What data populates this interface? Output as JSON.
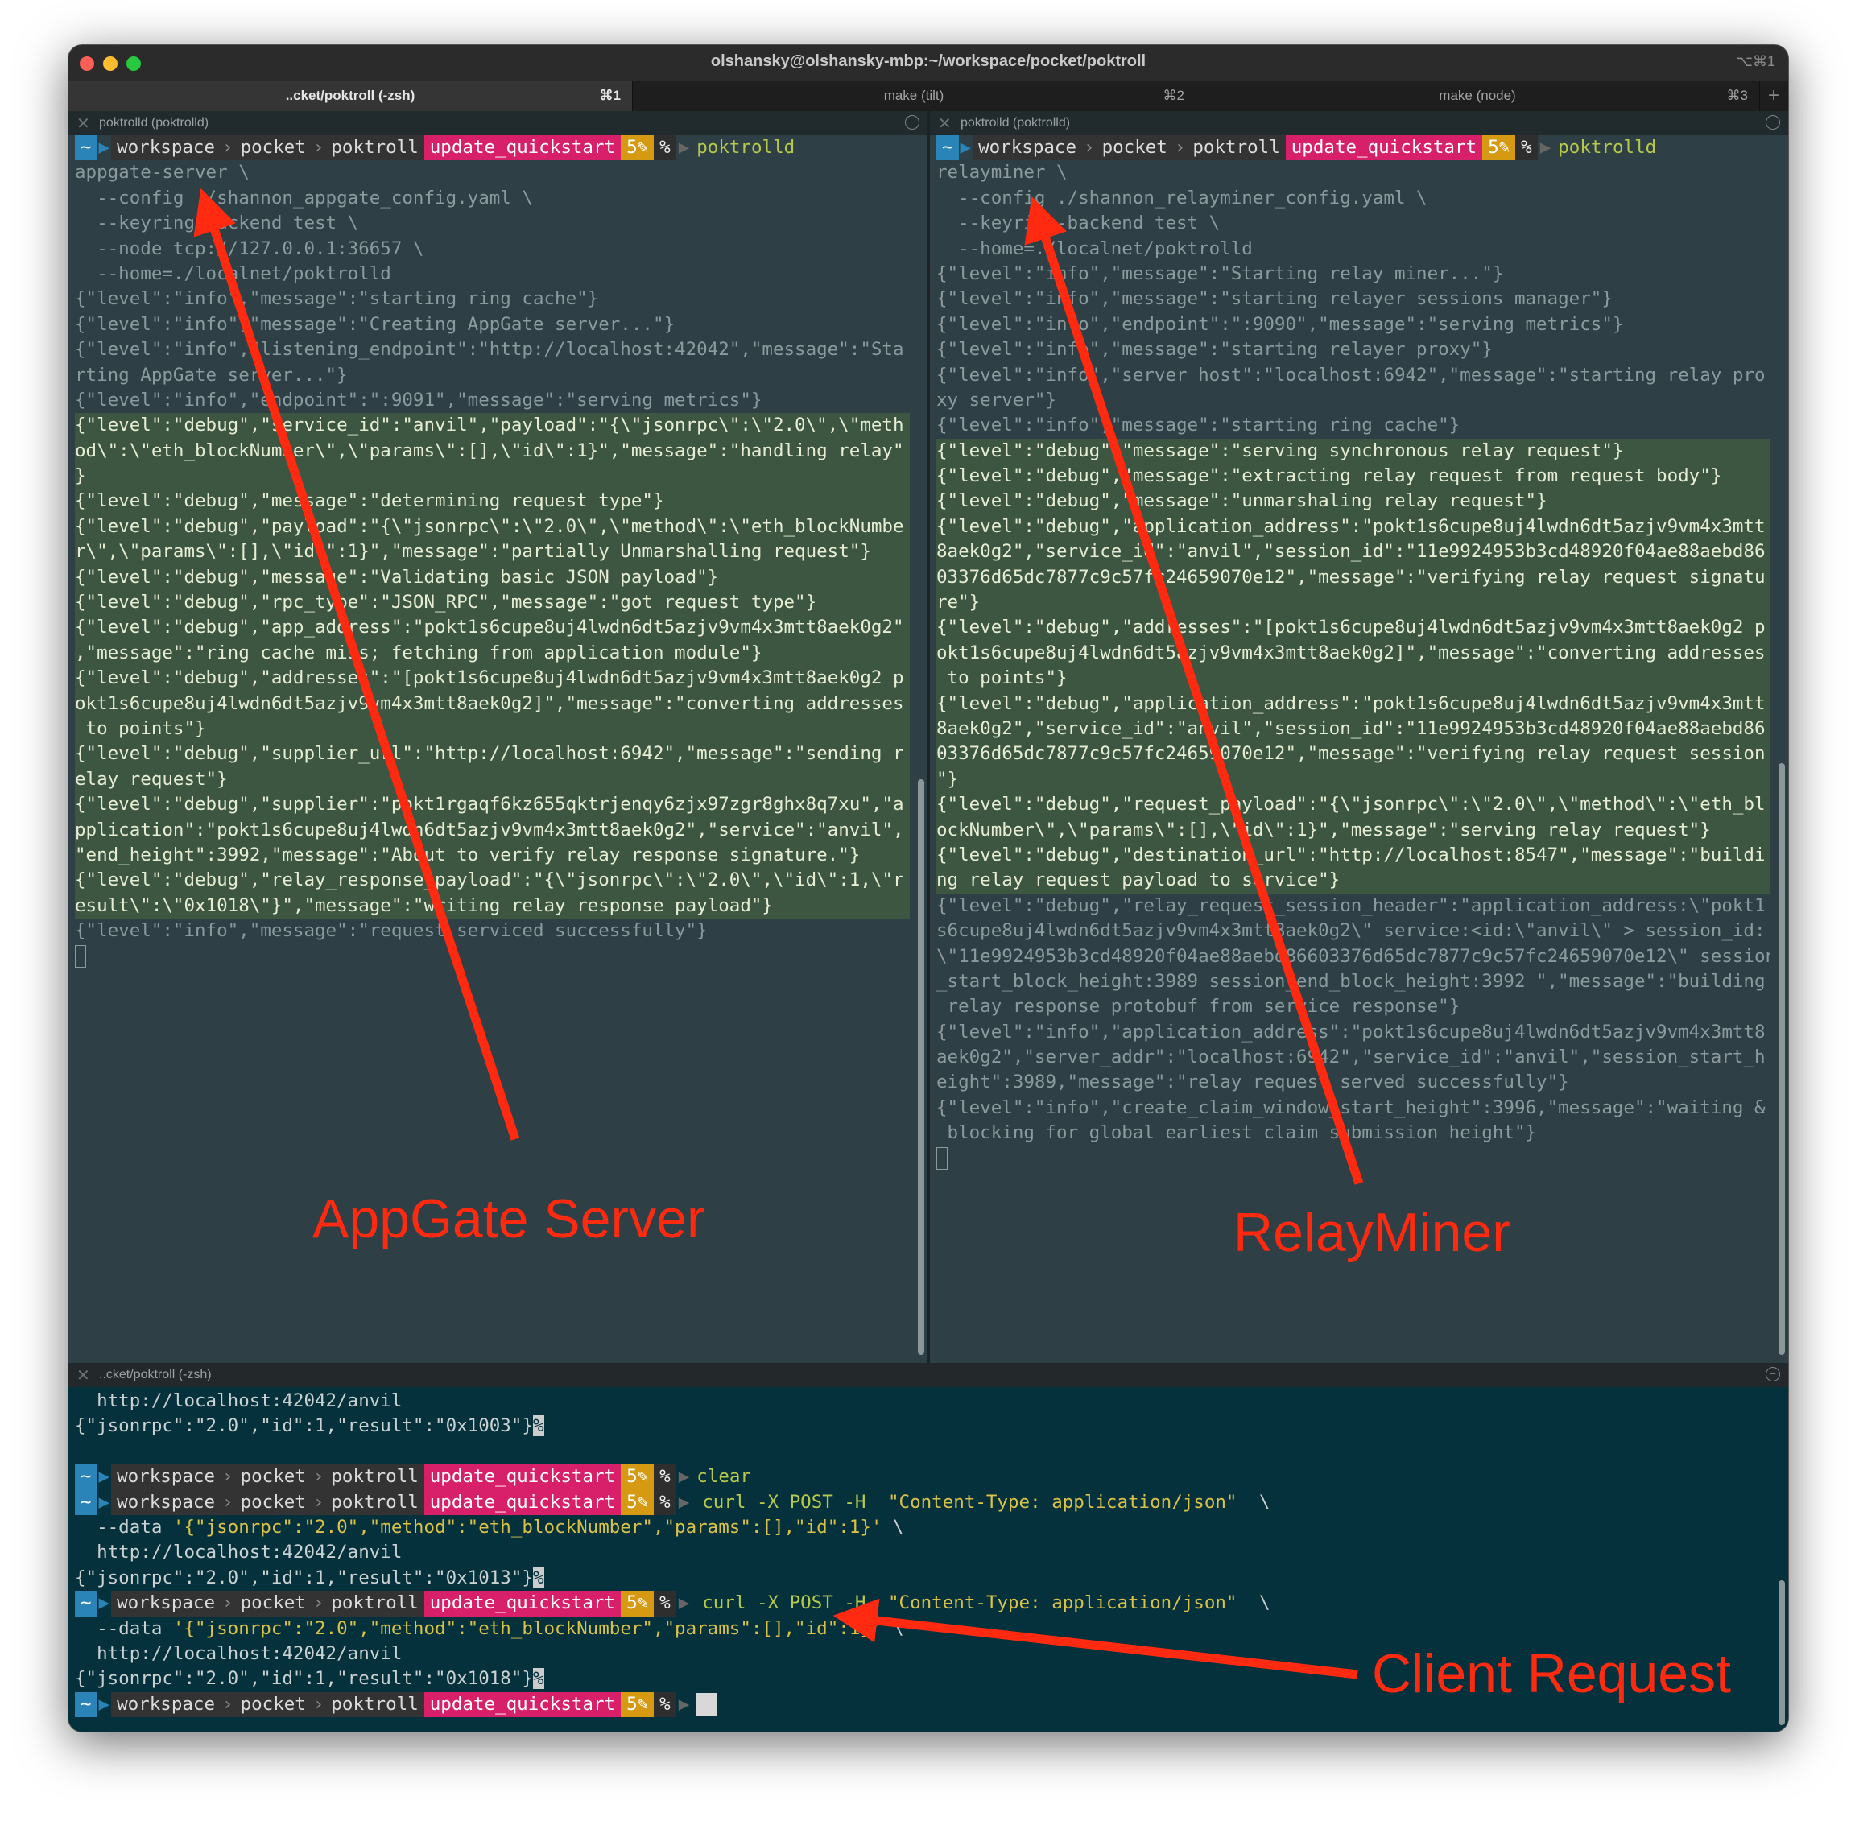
{
  "window": {
    "title": "olshansky@olshansky-mbp:~/workspace/pocket/poktroll",
    "shortcut": "⌥⌘1"
  },
  "tabs": [
    {
      "label": "..cket/poktroll (-zsh)",
      "key": "⌘1",
      "active": true
    },
    {
      "label": "make (tilt)",
      "key": "⌘2",
      "active": false
    },
    {
      "label": "make (node)",
      "key": "⌘3",
      "active": false
    }
  ],
  "prompt": {
    "home": "~",
    "dirs": [
      "workspace",
      "pocket",
      "poktroll"
    ],
    "branch": "update_quickstart",
    "count": "5✎",
    "symbol": "%"
  },
  "panes": {
    "left": {
      "title": "poktrolld (poktrolld)",
      "prompt_cmd": "poktrolld",
      "lines": [
        {
          "t": "appgate-server \\",
          "h": false
        },
        {
          "t": "  --config ./shannon_appgate_config.yaml \\",
          "h": false
        },
        {
          "t": "  --keyring-backend test \\",
          "h": false
        },
        {
          "t": "  --node tcp://127.0.0.1:36657 \\",
          "h": false
        },
        {
          "t": "  --home=./localnet/poktrolld",
          "h": false
        },
        {
          "t": "{\"level\":\"info\",\"message\":\"starting ring cache\"}",
          "h": false
        },
        {
          "t": "{\"level\":\"info\",\"message\":\"Creating AppGate server...\"}",
          "h": false
        },
        {
          "t": "{\"level\":\"info\",\"listening_endpoint\":\"http://localhost:42042\",\"message\":\"Sta",
          "h": false
        },
        {
          "t": "rting AppGate server...\"}",
          "h": false
        },
        {
          "t": "{\"level\":\"info\",\"endpoint\":\":9091\",\"message\":\"serving metrics\"}",
          "h": false
        },
        {
          "t": "{\"level\":\"debug\",\"service_id\":\"anvil\",\"payload\":\"{\\\"jsonrpc\\\":\\\"2.0\\\",\\\"meth",
          "h": true
        },
        {
          "t": "od\\\":\\\"eth_blockNumber\\\",\\\"params\\\":[],\\\"id\\\":1}\",\"message\":\"handling relay\"",
          "h": true
        },
        {
          "t": "}",
          "h": true
        },
        {
          "t": "{\"level\":\"debug\",\"message\":\"determining request type\"}",
          "h": true
        },
        {
          "t": "{\"level\":\"debug\",\"payload\":\"{\\\"jsonrpc\\\":\\\"2.0\\\",\\\"method\\\":\\\"eth_blockNumbe",
          "h": true
        },
        {
          "t": "r\\\",\\\"params\\\":[],\\\"id\\\":1}\",\"message\":\"partially Unmarshalling request\"}",
          "h": true
        },
        {
          "t": "{\"level\":\"debug\",\"message\":\"Validating basic JSON payload\"}",
          "h": true
        },
        {
          "t": "{\"level\":\"debug\",\"rpc_type\":\"JSON_RPC\",\"message\":\"got request type\"}",
          "h": true
        },
        {
          "t": "{\"level\":\"debug\",\"app_address\":\"pokt1s6cupe8uj4lwdn6dt5azjv9vm4x3mtt8aek0g2\"",
          "h": true
        },
        {
          "t": ",\"message\":\"ring cache miss; fetching from application module\"}",
          "h": true
        },
        {
          "t": "{\"level\":\"debug\",\"addresses\":\"[pokt1s6cupe8uj4lwdn6dt5azjv9vm4x3mtt8aek0g2 p",
          "h": true
        },
        {
          "t": "okt1s6cupe8uj4lwdn6dt5azjv9vm4x3mtt8aek0g2]\",\"message\":\"converting addresses",
          "h": true
        },
        {
          "t": " to points\"}",
          "h": true
        },
        {
          "t": "{\"level\":\"debug\",\"supplier_url\":\"http://localhost:6942\",\"message\":\"sending r",
          "h": true
        },
        {
          "t": "elay request\"}",
          "h": true
        },
        {
          "t": "{\"level\":\"debug\",\"supplier\":\"pokt1rgaqf6kz655qktrjenqy6zjx97zgr8ghx8q7xu\",\"a",
          "h": true
        },
        {
          "t": "pplication\":\"pokt1s6cupe8uj4lwdn6dt5azjv9vm4x3mtt8aek0g2\",\"service\":\"anvil\",",
          "h": true
        },
        {
          "t": "\"end_height\":3992,\"message\":\"About to verify relay response signature.\"}",
          "h": true
        },
        {
          "t": "{\"level\":\"debug\",\"relay_response_payload\":\"{\\\"jsonrpc\\\":\\\"2.0\\\",\\\"id\\\":1,\\\"r",
          "h": true
        },
        {
          "t": "esult\\\":\\\"0x1018\\\"}\",\"message\":\"writing relay response payload\"}",
          "h": true
        },
        {
          "t": "{\"level\":\"info\",\"message\":\"request serviced successfully\"}",
          "h": false
        }
      ]
    },
    "right": {
      "title": "poktrolld (poktrolld)",
      "prompt_cmd": "poktrolld",
      "lines": [
        {
          "t": "relayminer \\",
          "h": false
        },
        {
          "t": "  --config ./shannon_relayminer_config.yaml \\",
          "h": false
        },
        {
          "t": "  --keyring-backend test \\",
          "h": false
        },
        {
          "t": "  --home=./localnet/poktrolld",
          "h": false
        },
        {
          "t": "{\"level\":\"info\",\"message\":\"Starting relay miner...\"}",
          "h": false
        },
        {
          "t": "{\"level\":\"info\",\"message\":\"starting relayer sessions manager\"}",
          "h": false
        },
        {
          "t": "{\"level\":\"info\",\"endpoint\":\":9090\",\"message\":\"serving metrics\"}",
          "h": false
        },
        {
          "t": "{\"level\":\"info\",\"message\":\"starting relayer proxy\"}",
          "h": false
        },
        {
          "t": "{\"level\":\"info\",\"server host\":\"localhost:6942\",\"message\":\"starting relay pro",
          "h": false
        },
        {
          "t": "xy server\"}",
          "h": false
        },
        {
          "t": "{\"level\":\"info\",\"message\":\"starting ring cache\"}",
          "h": false
        },
        {
          "t": "{\"level\":\"debug\",\"message\":\"serving synchronous relay request\"}",
          "h": true
        },
        {
          "t": "{\"level\":\"debug\",\"message\":\"extracting relay request from request body\"}",
          "h": true
        },
        {
          "t": "{\"level\":\"debug\",\"message\":\"unmarshaling relay request\"}",
          "h": true
        },
        {
          "t": "{\"level\":\"debug\",\"application_address\":\"pokt1s6cupe8uj4lwdn6dt5azjv9vm4x3mtt",
          "h": true
        },
        {
          "t": "8aek0g2\",\"service_id\":\"anvil\",\"session_id\":\"11e9924953b3cd48920f04ae88aebd86",
          "h": true
        },
        {
          "t": "03376d65dc7877c9c57fc24659070e12\",\"message\":\"verifying relay request signatu",
          "h": true
        },
        {
          "t": "re\"}",
          "h": true
        },
        {
          "t": "{\"level\":\"debug\",\"addresses\":\"[pokt1s6cupe8uj4lwdn6dt5azjv9vm4x3mtt8aek0g2 p",
          "h": true
        },
        {
          "t": "okt1s6cupe8uj4lwdn6dt5azjv9vm4x3mtt8aek0g2]\",\"message\":\"converting addresses",
          "h": true
        },
        {
          "t": " to points\"}",
          "h": true
        },
        {
          "t": "{\"level\":\"debug\",\"application_address\":\"pokt1s6cupe8uj4lwdn6dt5azjv9vm4x3mtt",
          "h": true
        },
        {
          "t": "8aek0g2\",\"service_id\":\"anvil\",\"session_id\":\"11e9924953b3cd48920f04ae88aebd86",
          "h": true
        },
        {
          "t": "03376d65dc7877c9c57fc24659070e12\",\"message\":\"verifying relay request session",
          "h": true
        },
        {
          "t": "\"}",
          "h": true
        },
        {
          "t": "{\"level\":\"debug\",\"request_payload\":\"{\\\"jsonrpc\\\":\\\"2.0\\\",\\\"method\\\":\\\"eth_bl",
          "h": true
        },
        {
          "t": "ockNumber\\\",\\\"params\\\":[],\\\"id\\\":1}\",\"message\":\"serving relay request\"}",
          "h": true
        },
        {
          "t": "{\"level\":\"debug\",\"destination_url\":\"http://localhost:8547\",\"message\":\"buildi",
          "h": true
        },
        {
          "t": "ng relay request payload to service\"}",
          "h": true
        },
        {
          "t": "{\"level\":\"debug\",\"relay_request_session_header\":\"application_address:\\\"pokt1",
          "h": false
        },
        {
          "t": "s6cupe8uj4lwdn6dt5azjv9vm4x3mtt8aek0g2\\\" service:<id:\\\"anvil\\\" > session_id:",
          "h": false
        },
        {
          "t": "\\\"11e9924953b3cd48920f04ae88aebd86603376d65dc7877c9c57fc24659070e12\\\" session",
          "h": false
        },
        {
          "t": "_start_block_height:3989 session_end_block_height:3992 \",\"message\":\"building",
          "h": false
        },
        {
          "t": " relay response protobuf from service response\"}",
          "h": false
        },
        {
          "t": "{\"level\":\"info\",\"application_address\":\"pokt1s6cupe8uj4lwdn6dt5azjv9vm4x3mtt8",
          "h": false
        },
        {
          "t": "aek0g2\",\"server_addr\":\"localhost:6942\",\"service_id\":\"anvil\",\"session_start_h",
          "h": false
        },
        {
          "t": "eight\":3989,\"message\":\"relay request served successfully\"}",
          "h": false
        },
        {
          "t": "{\"level\":\"info\",\"create_claim_window_start_height\":3996,\"message\":\"waiting &",
          "h": false
        },
        {
          "t": " blocking for global earliest claim submission height\"}",
          "h": false
        }
      ]
    },
    "bottom": {
      "title": "..cket/poktroll (-zsh)",
      "url_line": "  http://localhost:42042/anvil",
      "result1": "{\"jsonrpc\":\"2.0\",\"id\":1,\"result\":\"0x1003\"}",
      "cmd_clear": "clear",
      "curl_cmd": "curl -X POST -H ",
      "content_type": "\"Content-Type: application/json\"",
      "line_end": " \\",
      "data_flag": "  --data ",
      "data_payload": "'{\"jsonrpc\":\"2.0\",\"method\":\"eth_blockNumber\",\"params\":[],\"id\":1}'",
      "result2": "{\"jsonrpc\":\"2.0\",\"id\":1,\"result\":\"0x1013\"}",
      "result3": "{\"jsonrpc\":\"2.0\",\"id\":1,\"result\":\"0x1018\"}",
      "eol_mark": "%"
    }
  },
  "annotations": {
    "appgate": "AppGate Server",
    "relayminer": "RelayMiner",
    "client": "Client Request",
    "color": "#ff2a10"
  }
}
